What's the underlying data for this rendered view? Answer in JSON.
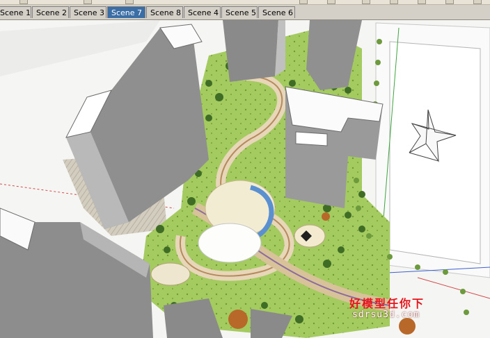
{
  "scene_tabs": [
    {
      "label": "Scene 1",
      "active": false
    },
    {
      "label": "Scene 2",
      "active": false
    },
    {
      "label": "Scene 3",
      "active": false
    },
    {
      "label": "Scene 7",
      "active": true
    },
    {
      "label": "Scene 8",
      "active": false
    },
    {
      "label": "Scene 4",
      "active": false
    },
    {
      "label": "Scene 5",
      "active": false
    },
    {
      "label": "Scene 6",
      "active": false
    }
  ],
  "watermark": {
    "chinese": "好模型任你下",
    "url": "sdrsu3d.com"
  },
  "colors": {
    "tab_active": "#3a6ea5",
    "lawn": "#9fc85a",
    "building_light": "#fbfbfb",
    "building_shadow": "#8c8c8c",
    "path": "#e7d4b8",
    "water": "#5a8fd0",
    "watermark_red": "#e8141c"
  },
  "icons": [
    "compass-rose-icon"
  ]
}
